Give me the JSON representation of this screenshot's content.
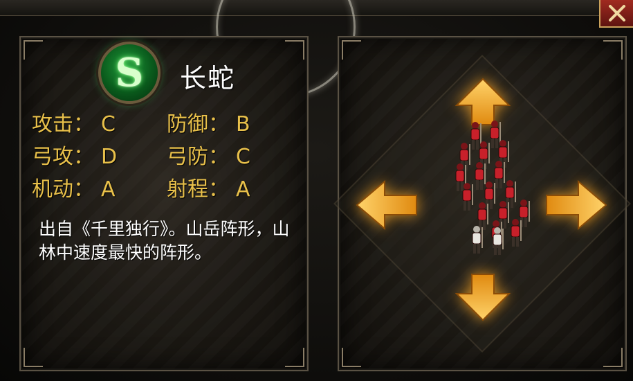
{
  "formation": {
    "badge_letter": "S",
    "name": "长蛇"
  },
  "stats": [
    [
      {
        "label": "攻击：",
        "value": "C"
      },
      {
        "label": "防御：",
        "value": "B"
      }
    ],
    [
      {
        "label": "弓攻：",
        "value": "D"
      },
      {
        "label": "弓防：",
        "value": "C"
      }
    ],
    [
      {
        "label": "机动：",
        "value": "A"
      },
      {
        "label": "射程：",
        "value": "A"
      }
    ]
  ],
  "description": "出自《千里独行》。山岳阵形，山林中速度最快的阵形。",
  "colors": {
    "stat_text": "#e8c04a",
    "arrow": "#f0a020",
    "badge": "#1e9a3a",
    "close": "#a02a20"
  },
  "icons": {
    "close": "close-icon",
    "arrows": [
      "arrow-up-icon",
      "arrow-down-icon",
      "arrow-left-icon",
      "arrow-right-icon"
    ]
  }
}
